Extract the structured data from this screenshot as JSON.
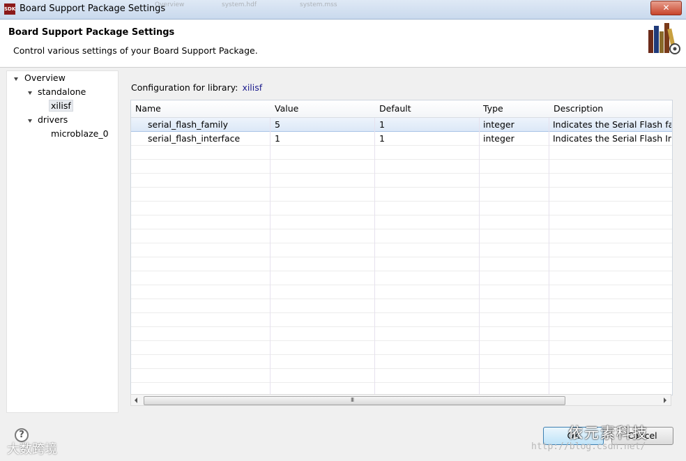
{
  "window": {
    "app_icon_text": "SDK",
    "title": "Board Support Package Settings",
    "close_label": "✕",
    "ghost_tabs": [
      "Overview",
      "system.hdf",
      "system.mss"
    ]
  },
  "header": {
    "title": "Board Support Package Settings",
    "description": "Control various settings of your Board Support Package."
  },
  "tree": {
    "items": [
      {
        "label": "Overview"
      },
      {
        "label": "standalone"
      },
      {
        "label": "xilisf"
      },
      {
        "label": "drivers"
      },
      {
        "label": "microblaze_0"
      }
    ]
  },
  "config": {
    "label": "Configuration for library:",
    "library": "xilisf"
  },
  "table": {
    "columns": [
      "Name",
      "Value",
      "Default",
      "Type",
      "Description"
    ],
    "rows": [
      {
        "name": "serial_flash_family",
        "value": "5",
        "default": "1",
        "type": "integer",
        "description": "Indicates the Serial Flash family"
      },
      {
        "name": "serial_flash_interface",
        "value": "1",
        "default": "1",
        "type": "integer",
        "description": "Indicates the Serial Flash Interface"
      }
    ]
  },
  "scrollbar": {
    "grip": "III"
  },
  "buttons": {
    "help": "?",
    "ok": "OK",
    "cancel": "Cancel"
  },
  "watermarks": {
    "brand": "依元素科技",
    "url": "http://blog.csdn.net/",
    "left": "大数跨境"
  }
}
